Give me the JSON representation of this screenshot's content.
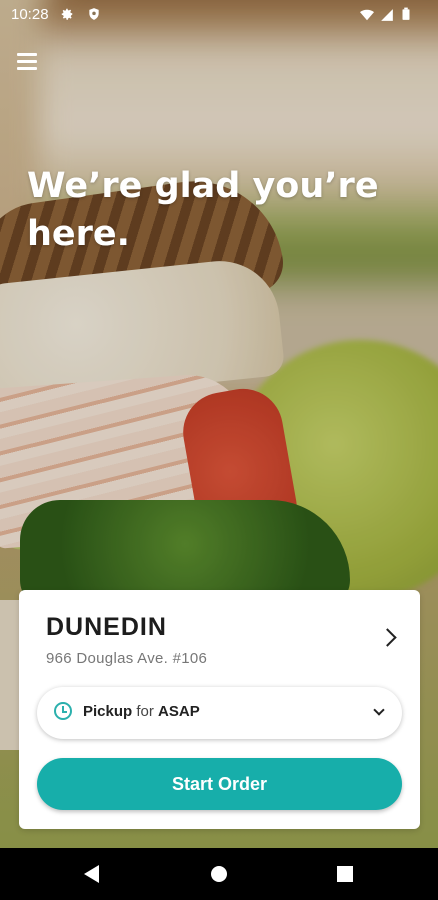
{
  "status_bar": {
    "time": "10:28",
    "icons": [
      "gear-icon",
      "shield-icon",
      "wifi-icon",
      "signal-icon",
      "battery-icon"
    ]
  },
  "header": {
    "menu_icon": "hamburger-menu-icon",
    "headline_line1": "We’re glad you’re",
    "headline_line2": "here."
  },
  "store": {
    "name": "DUNEDIN",
    "address": "966 Douglas Ave. #106"
  },
  "order_mode": {
    "mode": "Pickup",
    "connector": "for",
    "time": "ASAP",
    "icon": "clock-icon"
  },
  "actions": {
    "start_order_label": "Start Order"
  },
  "colors": {
    "accent": "#17aeaa",
    "clock_accent": "#2bb0ad"
  },
  "nav_bar": {
    "icons": [
      "back-icon",
      "home-icon",
      "recents-icon"
    ]
  }
}
